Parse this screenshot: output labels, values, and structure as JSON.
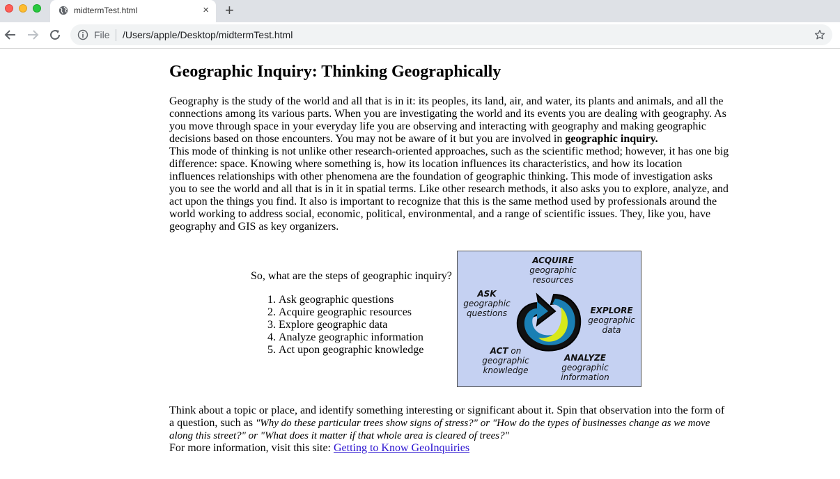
{
  "browser": {
    "tab_title": "midtermTest.html",
    "tab_close": "×",
    "new_tab": "+",
    "omnibox_scheme": "File",
    "omnibox_url": "/Users/apple/Desktop/midtermTest.html"
  },
  "page": {
    "title": "Geographic Inquiry: Thinking Geographically",
    "intro_text": "Geography is the study of the world and all that is in it: its peoples, its land, air, and water, its plants and animals, and all the connections among its various parts. When you are investigating the world and its events you are dealing with geography. As you move through space in your everyday life you are observing and interacting with geography and making geographic decisions based on those encounters. You may not be aware of it but you are involved in ",
    "intro_bold": "geographic inquiry.",
    "second_text": "This mode of thinking is not unlike other research-oriented approaches, such as the scientific method; however, it has one big difference: space. Knowing where something is, how its location influences its characteristics, and how its location influences relationships with other phenomena are the foundation of geographic thinking. This mode of investigation asks you to see the world and all that is in it in spatial terms. Like other research methods, it also asks you to explore, analyze, and act upon the things you find. It also is important to recognize that this is the same method used by professionals around the world working to address social, economic, political, environmental, and a range of scientific issues. They, like you, have geography and GIS as key organizers.",
    "steps_intro": "So, what are the steps of geographic inquiry?",
    "steps": [
      "Ask geographic questions",
      "Acquire geographic resources",
      "Explore geographic data",
      "Analyze geographic information",
      "Act upon geographic knowledge"
    ],
    "diagram": {
      "acquire_head": "ACQUIRE",
      "acquire_sub": "geographic resources",
      "ask_head": "ASK",
      "ask_sub": "geographic questions",
      "explore_head": "EXPLORE",
      "explore_sub": "geographic data",
      "analyze_head": "ANALYZE",
      "analyze_sub": "geographic information",
      "act_head": "ACT",
      "act_on": "on",
      "act_sub": "geographic knowledge"
    },
    "closing_text_a": "Think about a topic or place, and identify something interesting or significant about it. Spin that observation into the form of a question, such as ",
    "closing_q1": "\"Why do these particular trees show signs of stress?\"",
    "closing_or1": " or ",
    "closing_q2": "\"How do the types of businesses change as we move along this street?\"",
    "closing_or2": " or ",
    "closing_q3": "\"What does it matter if that whole area is cleared of trees?\"",
    "more_info": "For more information, visit this site: ",
    "link_text": "Getting to Know GeoInquiries"
  },
  "colors": {
    "diagram_bg": "#c5d1f2",
    "link": "#2a12d0"
  }
}
